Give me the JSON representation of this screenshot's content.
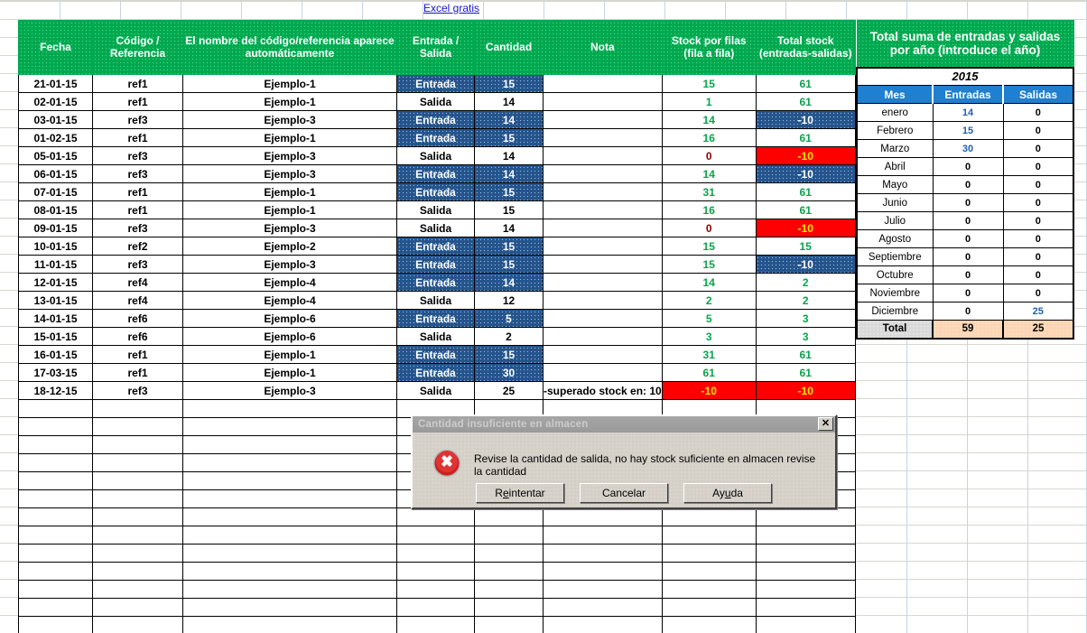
{
  "link": {
    "label": "Excel gratis"
  },
  "main_table": {
    "headers": [
      "Fecha",
      "Código / Referencia",
      "El nombre del código/referencia aparece automáticamente",
      "Entrada  / Salida",
      "Cantidad",
      "Nota",
      "Stock por filas (fila a fila)",
      "Total stock (entradas-salidas)"
    ],
    "rows": [
      {
        "fecha": "21-01-15",
        "codigo": "ref1",
        "nombre": "Ejemplo-1",
        "tipo": "Entrada",
        "tipo_fill": "navy",
        "cantidad": "15",
        "nota": "",
        "stock_filas": "15",
        "stock_filas_state": "pos",
        "total_stock": "61",
        "total_stock_state": "pos",
        "total_stock_fill": "none"
      },
      {
        "fecha": "02-01-15",
        "codigo": "ref1",
        "nombre": "Ejemplo-1",
        "tipo": "Salida",
        "tipo_fill": "none",
        "cantidad": "14",
        "nota": "",
        "stock_filas": "1",
        "stock_filas_state": "pos",
        "total_stock": "61",
        "total_stock_state": "pos",
        "total_stock_fill": "none"
      },
      {
        "fecha": "03-01-15",
        "codigo": "ref3",
        "nombre": "Ejemplo-3",
        "tipo": "Entrada",
        "tipo_fill": "navy",
        "cantidad": "14",
        "nota": "",
        "stock_filas": "14",
        "stock_filas_state": "pos",
        "total_stock": "-10",
        "total_stock_state": "white",
        "total_stock_fill": "navy"
      },
      {
        "fecha": "01-02-15",
        "codigo": "ref1",
        "nombre": "Ejemplo-1",
        "tipo": "Entrada",
        "tipo_fill": "navy",
        "cantidad": "15",
        "nota": "",
        "stock_filas": "16",
        "stock_filas_state": "pos",
        "total_stock": "61",
        "total_stock_state": "pos",
        "total_stock_fill": "none"
      },
      {
        "fecha": "05-01-15",
        "codigo": "ref3",
        "nombre": "Ejemplo-3",
        "tipo": "Salida",
        "tipo_fill": "none",
        "cantidad": "14",
        "nota": "",
        "stock_filas": "0",
        "stock_filas_state": "zero",
        "total_stock": "-10",
        "total_stock_state": "yellow",
        "total_stock_fill": "red"
      },
      {
        "fecha": "06-01-15",
        "codigo": "ref3",
        "nombre": "Ejemplo-3",
        "tipo": "Entrada",
        "tipo_fill": "navy",
        "cantidad": "14",
        "nota": "",
        "stock_filas": "14",
        "stock_filas_state": "pos",
        "total_stock": "-10",
        "total_stock_state": "white",
        "total_stock_fill": "navy"
      },
      {
        "fecha": "07-01-15",
        "codigo": "ref1",
        "nombre": "Ejemplo-1",
        "tipo": "Entrada",
        "tipo_fill": "navy",
        "cantidad": "15",
        "nota": "",
        "stock_filas": "31",
        "stock_filas_state": "pos",
        "total_stock": "61",
        "total_stock_state": "pos",
        "total_stock_fill": "none"
      },
      {
        "fecha": "08-01-15",
        "codigo": "ref1",
        "nombre": "Ejemplo-1",
        "tipo": "Salida",
        "tipo_fill": "none",
        "cantidad": "15",
        "nota": "",
        "stock_filas": "16",
        "stock_filas_state": "pos",
        "total_stock": "61",
        "total_stock_state": "pos",
        "total_stock_fill": "none"
      },
      {
        "fecha": "09-01-15",
        "codigo": "ref3",
        "nombre": "Ejemplo-3",
        "tipo": "Salida",
        "tipo_fill": "none",
        "cantidad": "14",
        "nota": "",
        "stock_filas": "0",
        "stock_filas_state": "zero",
        "total_stock": "-10",
        "total_stock_state": "yellow",
        "total_stock_fill": "red"
      },
      {
        "fecha": "10-01-15",
        "codigo": "ref2",
        "nombre": "Ejemplo-2",
        "tipo": "Entrada",
        "tipo_fill": "navy",
        "cantidad": "15",
        "nota": "",
        "stock_filas": "15",
        "stock_filas_state": "pos",
        "total_stock": "15",
        "total_stock_state": "pos",
        "total_stock_fill": "none"
      },
      {
        "fecha": "11-01-15",
        "codigo": "ref3",
        "nombre": "Ejemplo-3",
        "tipo": "Entrada",
        "tipo_fill": "navy",
        "cantidad": "15",
        "nota": "",
        "stock_filas": "15",
        "stock_filas_state": "pos",
        "total_stock": "-10",
        "total_stock_state": "white",
        "total_stock_fill": "navy"
      },
      {
        "fecha": "12-01-15",
        "codigo": "ref4",
        "nombre": "Ejemplo-4",
        "tipo": "Entrada",
        "tipo_fill": "navy",
        "cantidad": "14",
        "nota": "",
        "stock_filas": "14",
        "stock_filas_state": "pos",
        "total_stock": "2",
        "total_stock_state": "pos",
        "total_stock_fill": "none"
      },
      {
        "fecha": "13-01-15",
        "codigo": "ref4",
        "nombre": "Ejemplo-4",
        "tipo": "Salida",
        "tipo_fill": "none",
        "cantidad": "12",
        "nota": "",
        "stock_filas": "2",
        "stock_filas_state": "pos",
        "total_stock": "2",
        "total_stock_state": "pos",
        "total_stock_fill": "none"
      },
      {
        "fecha": "14-01-15",
        "codigo": "ref6",
        "nombre": "Ejemplo-6",
        "tipo": "Entrada",
        "tipo_fill": "navy",
        "cantidad": "5",
        "nota": "",
        "stock_filas": "5",
        "stock_filas_state": "pos",
        "total_stock": "3",
        "total_stock_state": "pos",
        "total_stock_fill": "none"
      },
      {
        "fecha": "15-01-15",
        "codigo": "ref6",
        "nombre": "Ejemplo-6",
        "tipo": "Salida",
        "tipo_fill": "none",
        "cantidad": "2",
        "nota": "",
        "stock_filas": "3",
        "stock_filas_state": "pos",
        "total_stock": "3",
        "total_stock_state": "pos",
        "total_stock_fill": "none"
      },
      {
        "fecha": "16-01-15",
        "codigo": "ref1",
        "nombre": "Ejemplo-1",
        "tipo": "Entrada",
        "tipo_fill": "navy",
        "cantidad": "15",
        "nota": "",
        "stock_filas": "31",
        "stock_filas_state": "pos",
        "total_stock": "61",
        "total_stock_state": "pos",
        "total_stock_fill": "none"
      },
      {
        "fecha": "17-03-15",
        "codigo": "ref1",
        "nombre": "Ejemplo-1",
        "tipo": "Entrada",
        "tipo_fill": "navy",
        "cantidad": "30",
        "nota": "",
        "stock_filas": "61",
        "stock_filas_state": "pos",
        "total_stock": "61",
        "total_stock_state": "pos",
        "total_stock_fill": "none"
      },
      {
        "fecha": "18-12-15",
        "codigo": "ref3",
        "nombre": "Ejemplo-3",
        "tipo": "Salida",
        "tipo_fill": "none",
        "cantidad": "25",
        "nota": "-superado stock en:  10",
        "stock_filas": "-10",
        "stock_filas_state": "yellow",
        "stock_filas_fill": "red",
        "total_stock": "-10",
        "total_stock_state": "yellow",
        "total_stock_fill": "red"
      }
    ],
    "empty_rows": 13
  },
  "summary_table": {
    "title": "Total suma de entradas y salidas por año (introduce el año)",
    "year": "2015",
    "columns": [
      "Mes",
      "Entradas",
      "Salidas"
    ],
    "rows": [
      {
        "mes": "enero",
        "entradas": "14",
        "entradas_blue": true,
        "salidas": "0",
        "salidas_blue": false
      },
      {
        "mes": "Febrero",
        "entradas": "15",
        "entradas_blue": true,
        "salidas": "0",
        "salidas_blue": false
      },
      {
        "mes": "Marzo",
        "entradas": "30",
        "entradas_blue": true,
        "salidas": "0",
        "salidas_blue": false
      },
      {
        "mes": "Abril",
        "entradas": "0",
        "entradas_blue": false,
        "salidas": "0",
        "salidas_blue": false
      },
      {
        "mes": "Mayo",
        "entradas": "0",
        "entradas_blue": false,
        "salidas": "0",
        "salidas_blue": false
      },
      {
        "mes": "Junio",
        "entradas": "0",
        "entradas_blue": false,
        "salidas": "0",
        "salidas_blue": false
      },
      {
        "mes": "Julio",
        "entradas": "0",
        "entradas_blue": false,
        "salidas": "0",
        "salidas_blue": false
      },
      {
        "mes": "Agosto",
        "entradas": "0",
        "entradas_blue": false,
        "salidas": "0",
        "salidas_blue": false
      },
      {
        "mes": "Septiembre",
        "entradas": "0",
        "entradas_blue": false,
        "salidas": "0",
        "salidas_blue": false
      },
      {
        "mes": "Octubre",
        "entradas": "0",
        "entradas_blue": false,
        "salidas": "0",
        "salidas_blue": false
      },
      {
        "mes": "Noviembre",
        "entradas": "0",
        "entradas_blue": false,
        "salidas": "0",
        "salidas_blue": false
      },
      {
        "mes": "Diciembre",
        "entradas": "0",
        "entradas_blue": false,
        "salidas": "25",
        "salidas_blue": true
      }
    ],
    "total": {
      "label": "Total",
      "entradas": "59",
      "salidas": "25"
    }
  },
  "dialog": {
    "title": "Cantidad insuficiente en almacen",
    "close_label": "✕",
    "message": "Revise la cantidad de salida, no hay stock suficiente en almacen revise la cantidad",
    "buttons": [
      {
        "pre": "R",
        "accel": "e",
        "post": "intentar"
      },
      {
        "pre": "C",
        "accel": "",
        "post": "ancelar"
      },
      {
        "pre": "Ay",
        "accel": "u",
        "post": "da"
      }
    ]
  },
  "colors": {
    "header_green": "#00a94f",
    "fill_navy": "#24548c",
    "fill_red": "#ff0000",
    "positive_green": "#0aa34c",
    "blue_header": "#1f7fd0",
    "total_peach": "#fcd5b4",
    "link_blue": "#1414cc"
  }
}
